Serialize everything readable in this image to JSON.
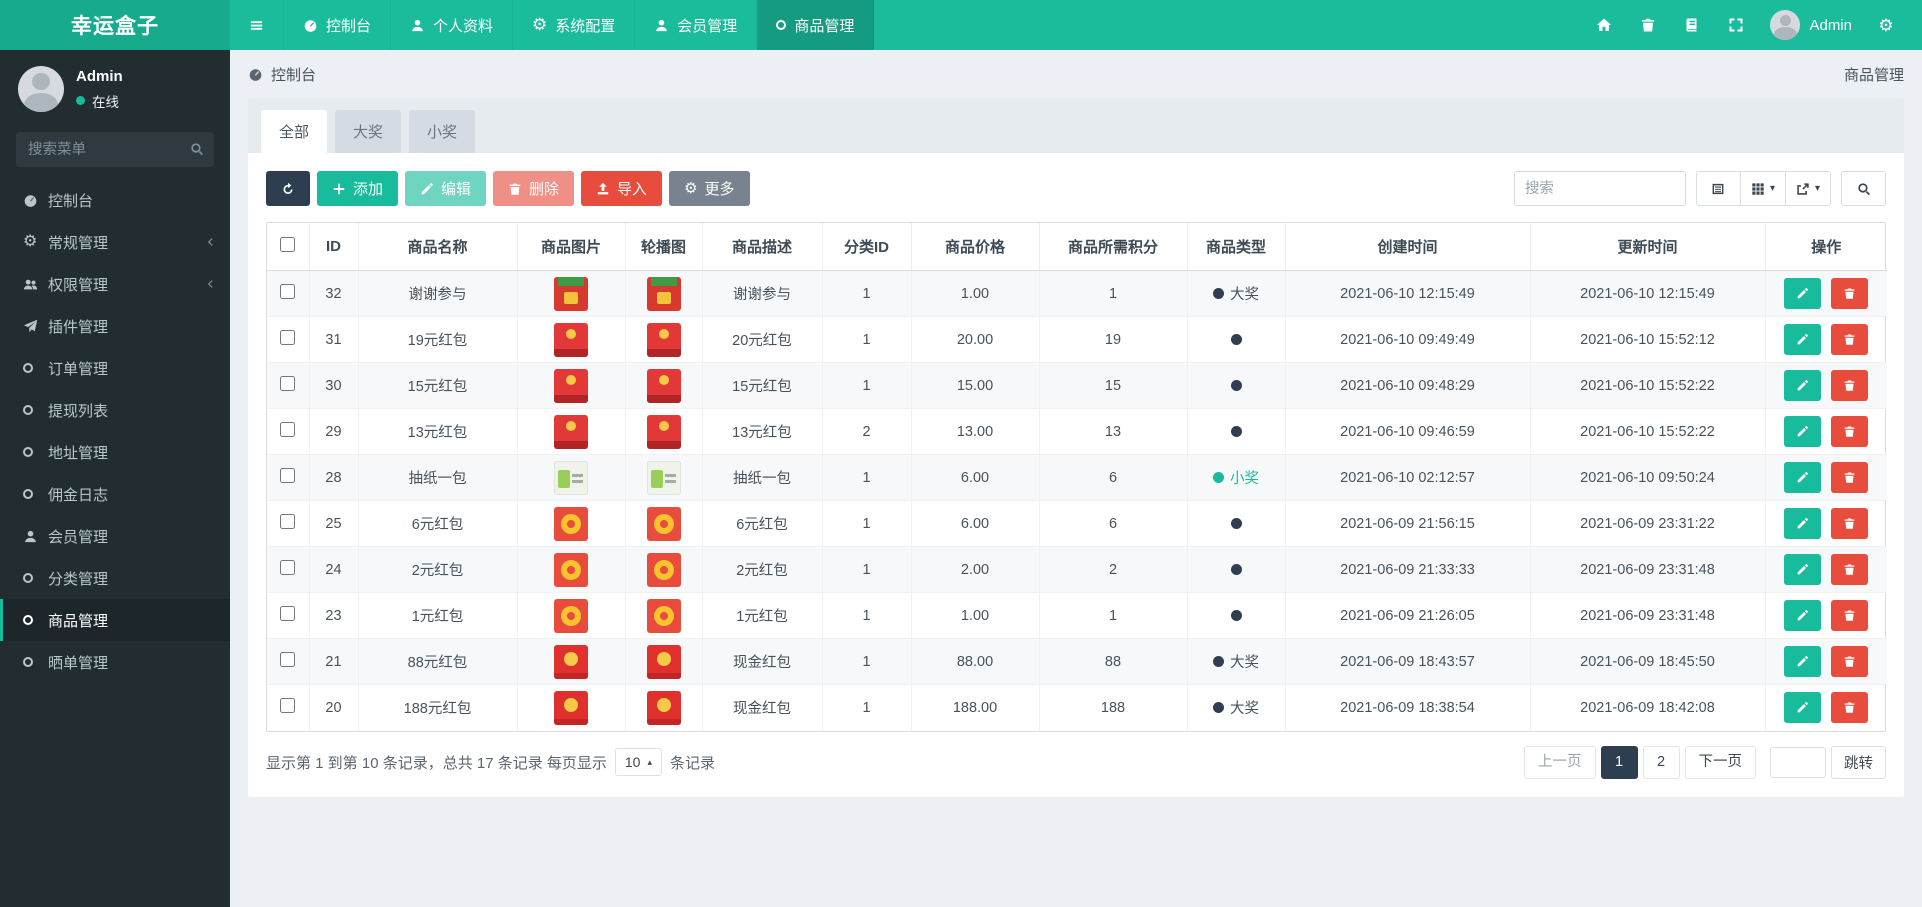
{
  "colors": {
    "accent": "#18bc9c",
    "navbar": "#1abc9c",
    "navbar_active": "#159b81",
    "dark": "#2c3e50",
    "danger": "#e74c3c",
    "sidebar": "#222d32",
    "page_bg": "#ecf0f5"
  },
  "navbar": {
    "brand": "幸运盒子",
    "menu": [
      {
        "key": "sidebar-toggle",
        "icon": "bars",
        "label": "",
        "active": false
      },
      {
        "key": "dashboard",
        "icon": "gauge",
        "label": "控制台",
        "active": false
      },
      {
        "key": "profile",
        "icon": "user",
        "label": "个人资料",
        "active": false
      },
      {
        "key": "system-config",
        "icon": "gear",
        "label": "系统配置",
        "active": false
      },
      {
        "key": "member-management",
        "icon": "user",
        "label": "会员管理",
        "active": false
      },
      {
        "key": "product-management",
        "icon": "circle",
        "label": "商品管理",
        "active": true
      }
    ],
    "right_icons": [
      {
        "key": "home",
        "icon": "home"
      },
      {
        "key": "trash",
        "icon": "trash"
      },
      {
        "key": "book",
        "icon": "book"
      },
      {
        "key": "fullscreen",
        "icon": "expand"
      }
    ],
    "user": {
      "name": "Admin"
    },
    "settings_icon": "gears"
  },
  "sidebar": {
    "user": {
      "name": "Admin",
      "status": "在线"
    },
    "search_placeholder": "搜索菜单",
    "items": [
      {
        "key": "dashboard",
        "icon": "gauge",
        "label": "控制台",
        "active": false,
        "chevron": false
      },
      {
        "key": "general",
        "icon": "gear",
        "label": "常规管理",
        "active": false,
        "chevron": true
      },
      {
        "key": "auth",
        "icon": "users",
        "label": "权限管理",
        "active": false,
        "chevron": true
      },
      {
        "key": "addon",
        "icon": "plane",
        "label": "插件管理",
        "active": false,
        "chevron": false
      },
      {
        "key": "order",
        "icon": "circle",
        "label": "订单管理",
        "active": false,
        "chevron": false
      },
      {
        "key": "withdraw",
        "icon": "circle",
        "label": "提现列表",
        "active": false,
        "chevron": false
      },
      {
        "key": "address",
        "icon": "circle",
        "label": "地址管理",
        "active": false,
        "chevron": false
      },
      {
        "key": "commission",
        "icon": "circle",
        "label": "佣金日志",
        "active": false,
        "chevron": false
      },
      {
        "key": "member",
        "icon": "user",
        "label": "会员管理",
        "active": false,
        "chevron": false
      },
      {
        "key": "category",
        "icon": "circle",
        "label": "分类管理",
        "active": false,
        "chevron": false
      },
      {
        "key": "product",
        "icon": "circle",
        "label": "商品管理",
        "active": true,
        "chevron": false
      },
      {
        "key": "share-order",
        "icon": "circle",
        "label": "晒单管理",
        "active": false,
        "chevron": false
      }
    ]
  },
  "breadcrumb": {
    "left": "控制台",
    "right": "商品管理"
  },
  "tabs": [
    {
      "key": "all",
      "label": "全部",
      "active": true
    },
    {
      "key": "big-prize",
      "label": "大奖",
      "active": false
    },
    {
      "key": "small-prize",
      "label": "小奖",
      "active": false
    }
  ],
  "toolbar": {
    "buttons": [
      {
        "key": "refresh",
        "icon": "refresh",
        "label": "",
        "variant": "dark",
        "disabled": false
      },
      {
        "key": "add",
        "icon": "plus",
        "label": "添加",
        "variant": "success",
        "disabled": false
      },
      {
        "key": "edit",
        "icon": "pencil",
        "label": "编辑",
        "variant": "success",
        "disabled": true
      },
      {
        "key": "delete",
        "icon": "trash",
        "label": "删除",
        "variant": "danger",
        "disabled": true
      },
      {
        "key": "import",
        "icon": "upload",
        "label": "导入",
        "variant": "danger",
        "disabled": false
      },
      {
        "key": "more",
        "icon": "gear",
        "label": "更多",
        "variant": "secondary",
        "disabled": false
      }
    ],
    "search_placeholder": "搜索",
    "view_buttons": [
      {
        "key": "detail-view",
        "icon": "list",
        "caret": false
      },
      {
        "key": "columns",
        "icon": "grid",
        "caret": true
      },
      {
        "key": "export",
        "icon": "export",
        "caret": true
      }
    ]
  },
  "table": {
    "columns": [
      "ID",
      "商品名称",
      "商品图片",
      "轮播图",
      "商品描述",
      "分类ID",
      "商品价格",
      "商品所需积分",
      "商品类型",
      "创建时间",
      "更新时间",
      "操作"
    ],
    "rows": [
      {
        "id": "32",
        "name": "谢谢参与",
        "thumb": "giftbox",
        "desc": "谢谢参与",
        "category_id": "1",
        "price": "1.00",
        "score": "1",
        "type": {
          "label": "大奖",
          "variant": "dark"
        },
        "created": "2021-06-10 12:15:49",
        "updated": "2021-06-10 12:15:49"
      },
      {
        "id": "31",
        "name": "19元红包",
        "thumb": "envelope",
        "desc": "20元红包",
        "category_id": "1",
        "price": "20.00",
        "score": "19",
        "type": {
          "label": "",
          "variant": "dark"
        },
        "created": "2021-06-10 09:49:49",
        "updated": "2021-06-10 15:52:12"
      },
      {
        "id": "30",
        "name": "15元红包",
        "thumb": "envelope",
        "desc": "15元红包",
        "category_id": "1",
        "price": "15.00",
        "score": "15",
        "type": {
          "label": "",
          "variant": "dark"
        },
        "created": "2021-06-10 09:48:29",
        "updated": "2021-06-10 15:52:22"
      },
      {
        "id": "29",
        "name": "13元红包",
        "thumb": "envelope",
        "desc": "13元红包",
        "category_id": "2",
        "price": "13.00",
        "score": "13",
        "type": {
          "label": "",
          "variant": "dark"
        },
        "created": "2021-06-10 09:46:59",
        "updated": "2021-06-10 15:52:22"
      },
      {
        "id": "28",
        "name": "抽纸一包",
        "thumb": "tissue",
        "desc": "抽纸一包",
        "category_id": "1",
        "price": "6.00",
        "score": "6",
        "type": {
          "label": "小奖",
          "variant": "teal"
        },
        "created": "2021-06-10 02:12:57",
        "updated": "2021-06-10 09:50:24"
      },
      {
        "id": "25",
        "name": "6元红包",
        "thumb": "seal",
        "desc": "6元红包",
        "category_id": "1",
        "price": "6.00",
        "score": "6",
        "type": {
          "label": "",
          "variant": "dark"
        },
        "created": "2021-06-09 21:56:15",
        "updated": "2021-06-09 23:31:22"
      },
      {
        "id": "24",
        "name": "2元红包",
        "thumb": "seal",
        "desc": "2元红包",
        "category_id": "1",
        "price": "2.00",
        "score": "2",
        "type": {
          "label": "",
          "variant": "dark"
        },
        "created": "2021-06-09 21:33:33",
        "updated": "2021-06-09 23:31:48"
      },
      {
        "id": "23",
        "name": "1元红包",
        "thumb": "seal",
        "desc": "1元红包",
        "category_id": "1",
        "price": "1.00",
        "score": "1",
        "type": {
          "label": "",
          "variant": "dark"
        },
        "created": "2021-06-09 21:26:05",
        "updated": "2021-06-09 23:31:48"
      },
      {
        "id": "21",
        "name": "88元红包",
        "thumb": "packet",
        "desc": "现金红包",
        "category_id": "1",
        "price": "88.00",
        "score": "88",
        "type": {
          "label": "大奖",
          "variant": "dark"
        },
        "created": "2021-06-09 18:43:57",
        "updated": "2021-06-09 18:45:50"
      },
      {
        "id": "20",
        "name": "188元红包",
        "thumb": "packet",
        "desc": "现金红包",
        "category_id": "1",
        "price": "188.00",
        "score": "188",
        "type": {
          "label": "大奖",
          "variant": "dark"
        },
        "created": "2021-06-09 18:38:54",
        "updated": "2021-06-09 18:42:08"
      }
    ]
  },
  "pagination": {
    "info_prefix": "显示第 1 到第 10 条记录，总共 17 条记录 每页显示",
    "page_size": "10",
    "info_suffix": "条记录",
    "prev": "上一页",
    "next": "下一页",
    "pages": [
      {
        "label": "1",
        "active": true
      },
      {
        "label": "2",
        "active": false
      }
    ],
    "jump_label": "跳转"
  }
}
